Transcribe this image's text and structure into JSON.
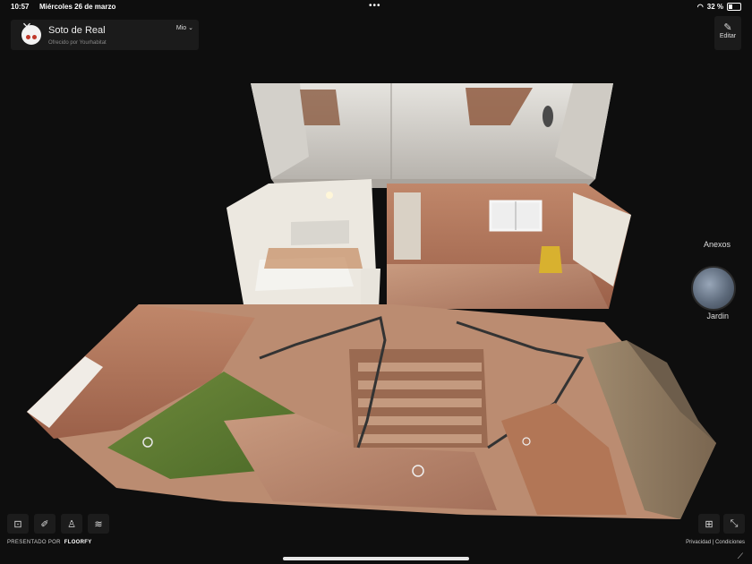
{
  "status": {
    "time": "10:57",
    "date": "Miércoles 26 de marzo",
    "dots": "•••",
    "battery": "32 %"
  },
  "header": {
    "close_icon": "×",
    "title": "Soto de Real",
    "subtitle": "Ofrecido por Yourhabitat",
    "floor_selector": "Mio ⌄"
  },
  "edit": {
    "icon": "✎",
    "label": "Editar"
  },
  "side": {
    "group_label": "Anexos",
    "item_label": "Jardin"
  },
  "footer": {
    "presented_prefix": "PRESENTADO POR",
    "brand": "FLOORFY",
    "links": "Privacidad | Condiciones"
  },
  "tools": {
    "t1": "⊡",
    "t2": "✐",
    "t3": "♙",
    "t4": "≋",
    "r1": "⊞",
    "r2": "⤡"
  }
}
